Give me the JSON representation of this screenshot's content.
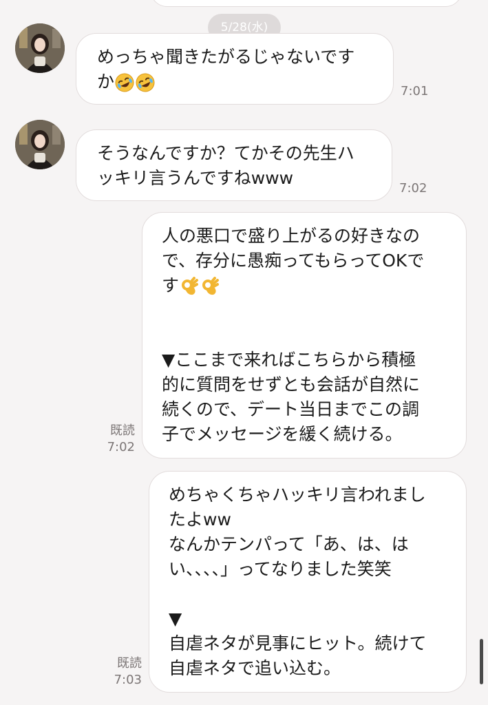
{
  "date_label": "5/28(水)",
  "messages": [
    {
      "lines": [
        "めっちゃ聞きたがるじゃないです",
        "か"
      ],
      "emoji": [
        "rofl-emoji",
        "rofl-emoji"
      ],
      "time": "7:01"
    },
    {
      "lines": [
        "そうなんですか？てかその先生ハ",
        "ッキリ言うんですねwww"
      ],
      "time": "7:02"
    },
    {
      "lines": [
        "人の悪口で盛り上がるの好きなの",
        "で、存分に愚痴ってもらってOKで",
        "す",
        "",
        "",
        "▼ここまで来ればこちらから積極",
        "的に質問をせずとも会話が自然に",
        "続くので、デート当日までこの調",
        "子でメッセージを緩く続ける。"
      ],
      "emoji": [
        "ok-hand-emoji",
        "ok-hand-emoji"
      ],
      "read": "既読",
      "time": "7:02"
    },
    {
      "lines": [
        "めちゃくちゃハッキリ言われまし",
        "たよww",
        "なんかテンパって「あ、は、は",
        "い、、、、」ってなりました笑笑",
        "",
        "▼",
        "自虐ネタが見事にヒット。続けて",
        "自虐ネタで追い込む。"
      ],
      "read": "既読",
      "time": "7:03"
    }
  ],
  "colors": {
    "background": "#f6f4f4",
    "bubble": "#ffffff",
    "bubble_border": "#e2dcdc",
    "timestamp": "#7b7575",
    "date_pill": "#dedada"
  }
}
